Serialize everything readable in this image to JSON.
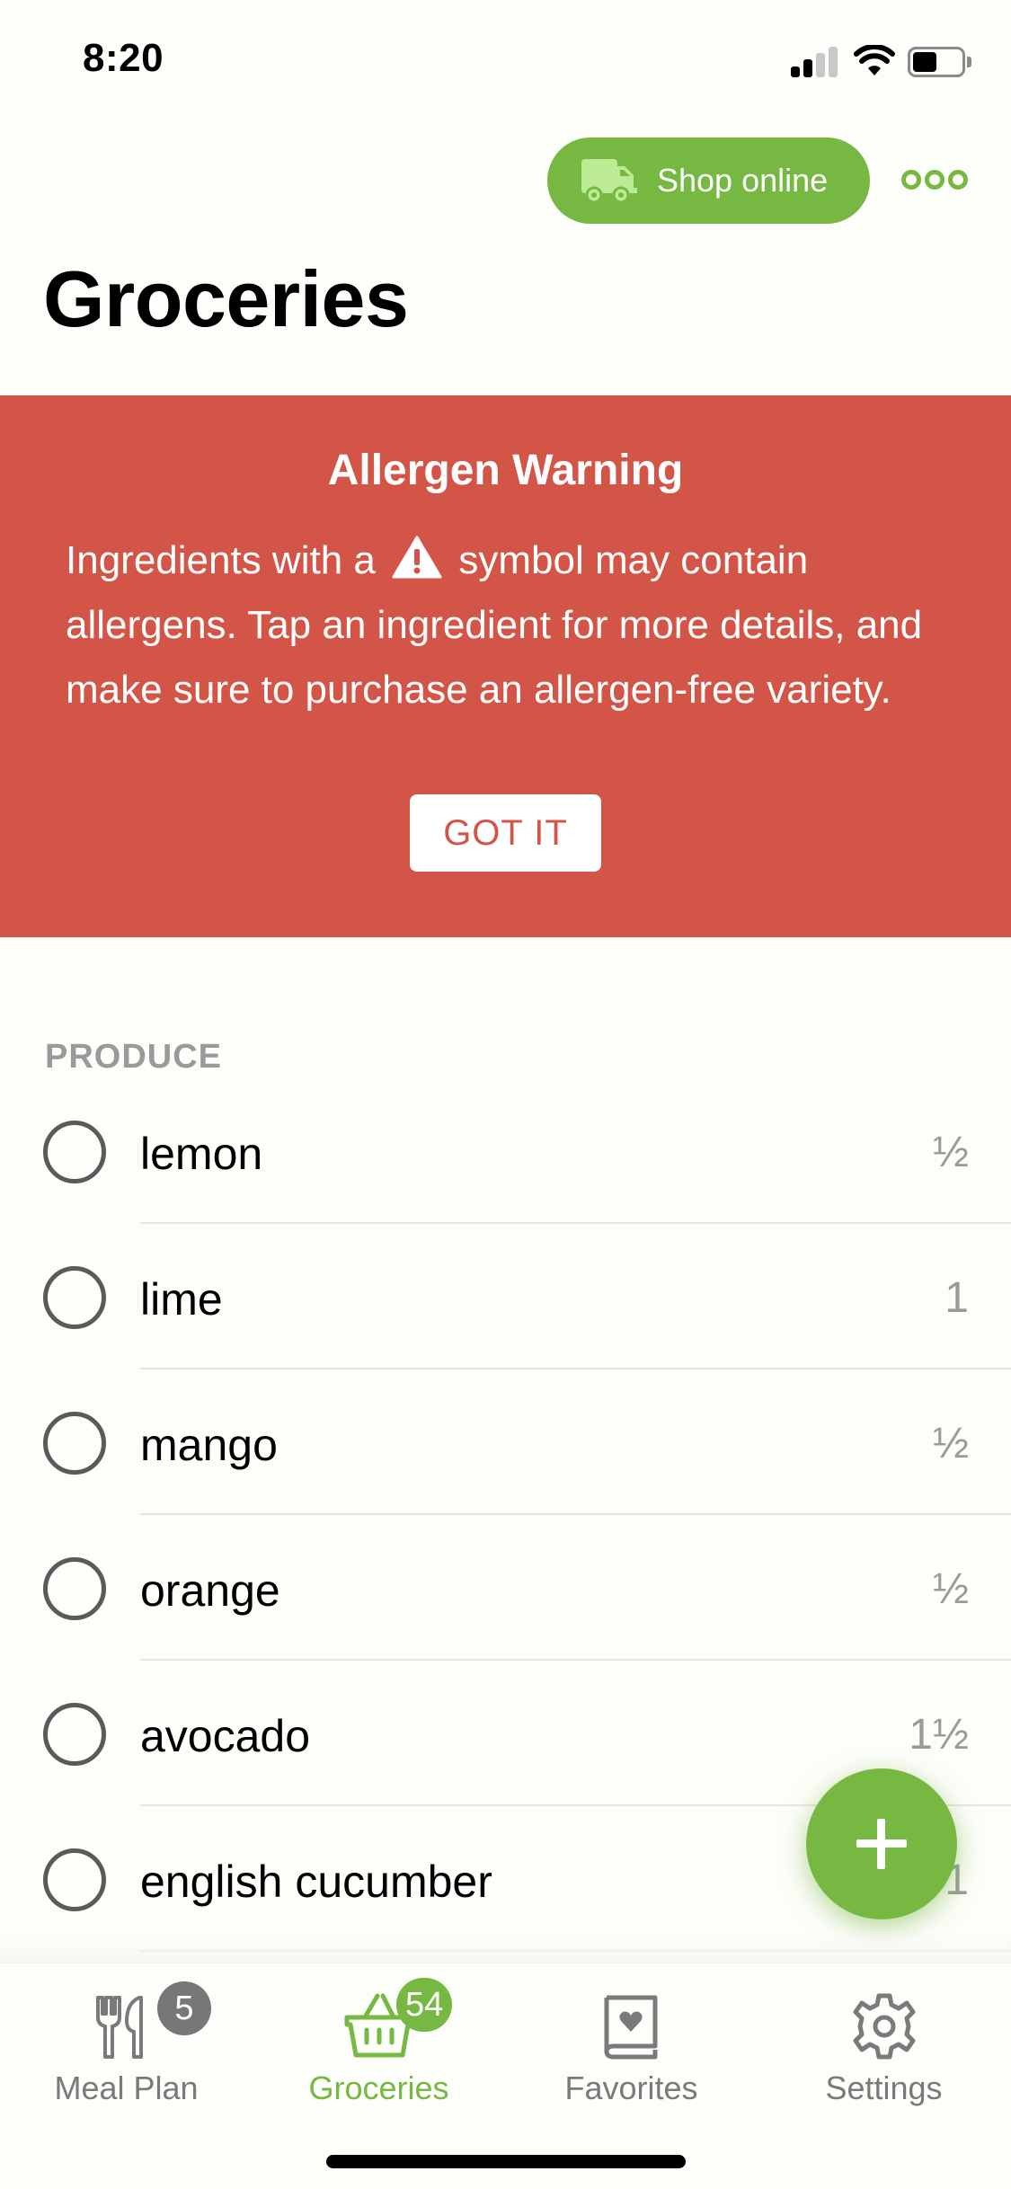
{
  "status_bar": {
    "time": "8:20",
    "signal_bars_active": 2,
    "signal_bars_total": 4,
    "battery_level_percent": 50
  },
  "header": {
    "shop_online_label": "Shop online",
    "shop_online_icon": "truck-icon",
    "more_icon": "more-dots-icon",
    "title": "Groceries"
  },
  "banner": {
    "title": "Allergen Warning",
    "text_before_icon": "Ingredients with a",
    "icon": "warning-triangle-icon",
    "text_after_icon": "symbol may contain allergens. Tap an ingredient for more details, and make sure to purchase an allergen-free variety.",
    "button_label": "GOT IT"
  },
  "sections": [
    {
      "header": "PRODUCE",
      "items": [
        {
          "name": "lemon",
          "qty": "½",
          "checked": false
        },
        {
          "name": "lime",
          "qty": "1",
          "checked": false
        },
        {
          "name": "mango",
          "qty": "½",
          "checked": false
        },
        {
          "name": "orange",
          "qty": "½",
          "checked": false
        },
        {
          "name": "avocado",
          "qty": "1½",
          "checked": false
        },
        {
          "name": "english cucumber",
          "qty": "1",
          "checked": false
        }
      ]
    }
  ],
  "fab": {
    "icon": "plus-icon"
  },
  "tabs": [
    {
      "label": "Meal Plan",
      "icon": "fork-knife-icon",
      "badge": "5",
      "active": false
    },
    {
      "label": "Groceries",
      "icon": "basket-icon",
      "badge": "54",
      "active": true
    },
    {
      "label": "Favorites",
      "icon": "heart-book-icon",
      "badge": null,
      "active": false
    },
    {
      "label": "Settings",
      "icon": "gear-icon",
      "badge": null,
      "active": false
    }
  ],
  "colors": {
    "accent": "#76b842",
    "banner": "#d35548",
    "muted_text": "#9a9a9a",
    "tab_inactive": "#7a7a7a"
  }
}
